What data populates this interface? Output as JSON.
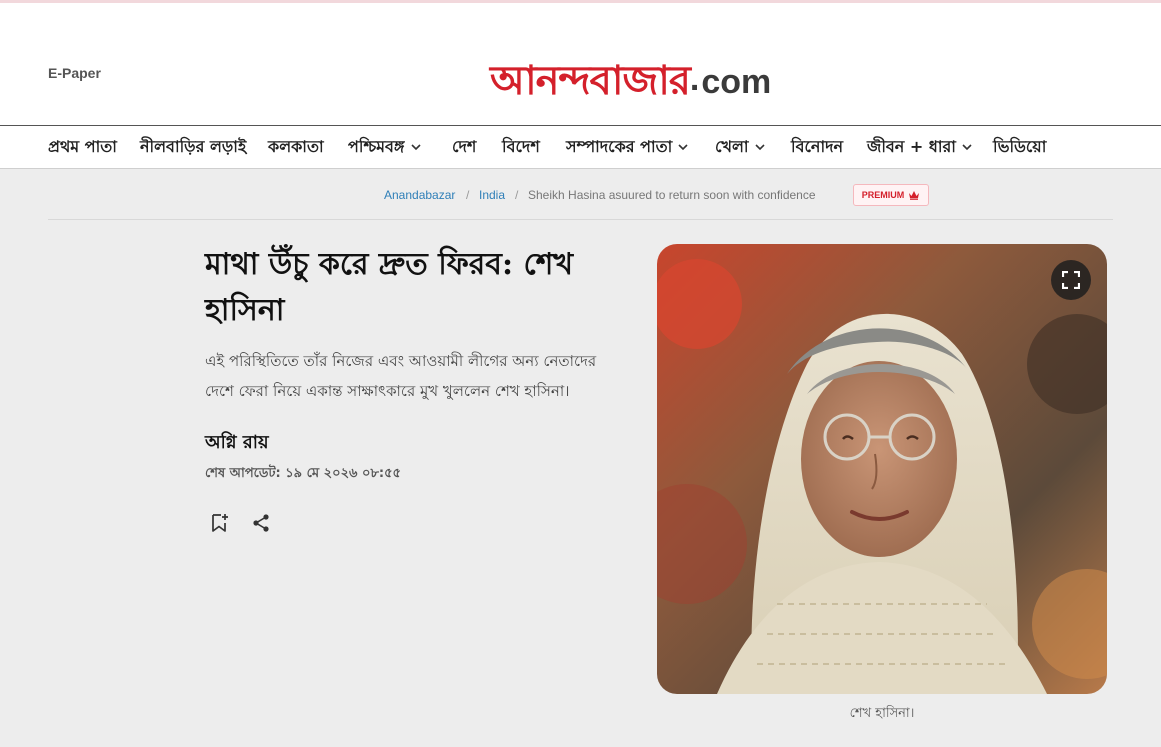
{
  "header": {
    "epaper_label": "E-Paper",
    "logo_bengali": "আনন্দবাজার",
    "logo_suffix": "com",
    "brand_color": "#d4202b"
  },
  "nav": {
    "items": [
      {
        "label": "প্রথম পাতা",
        "has_dropdown": false
      },
      {
        "label": "নীলবাড়ির লড়াই",
        "has_dropdown": false
      },
      {
        "label": "কলকাতা",
        "has_dropdown": false
      },
      {
        "label": "পশ্চিমবঙ্গ",
        "has_dropdown": true
      },
      {
        "label": "দেশ",
        "has_dropdown": false
      },
      {
        "label": "বিদেশ",
        "has_dropdown": false
      },
      {
        "label": "সম্পাদকের পাতা",
        "has_dropdown": true
      },
      {
        "label": "খেলা",
        "has_dropdown": true
      },
      {
        "label": "বিনোদন",
        "has_dropdown": false
      },
      {
        "label": "জীবন + ধারা",
        "has_dropdown": true
      },
      {
        "label": "ভিডিয়ো",
        "has_dropdown": false
      }
    ]
  },
  "breadcrumb": {
    "home": "Anandabazar",
    "section": "India",
    "current": "Sheikh Hasina asuured to return soon with confidence",
    "separator": "/",
    "badge": "PREMIUM",
    "badge_icon": "crown-icon"
  },
  "article": {
    "headline": "মাথা উঁচু করে দ্রুত ফিরব: শেখ হাসিনা",
    "summary": "এই পরিস্থিতিতে তাঁর নিজের এবং আওয়ামী লীগের অন্য নেতাদের দেশে ফেরা নিয়ে একান্ত সাক্ষাৎকারে মুখ খুললেন শেখ হাসিনা।",
    "author": "অগ্নি রায়",
    "updated": "শেষ আপডেট: ১৯ মে ২০২৬ ০৮:৫৫",
    "actions": [
      "bookmark-add-icon",
      "share-icon"
    ],
    "image_caption": "শেখ হাসিনা।",
    "image_icon": "expand-icon"
  }
}
